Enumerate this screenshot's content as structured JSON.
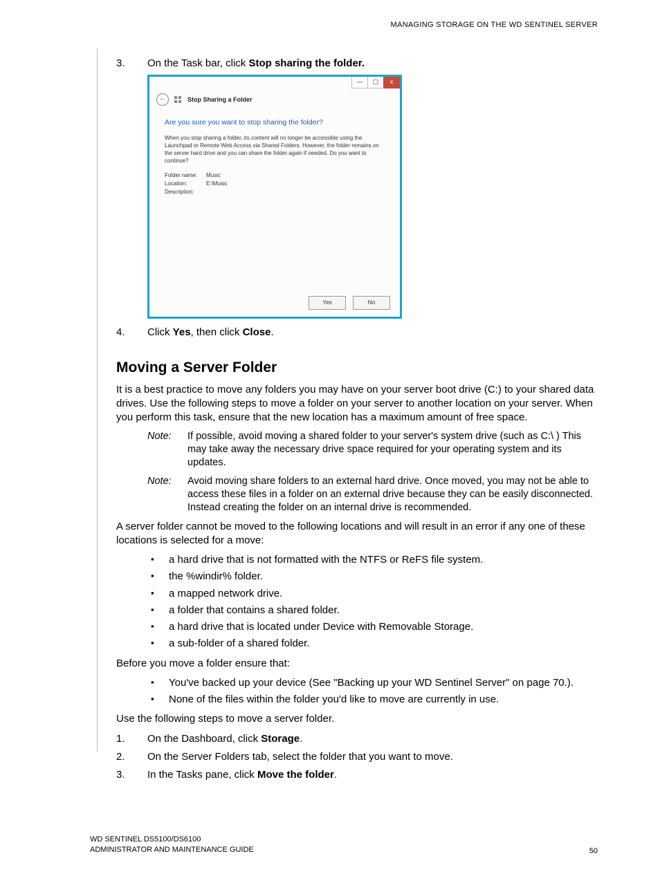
{
  "header": "MANAGING STORAGE ON THE WD SENTINEL SERVER",
  "step3": {
    "num": "3.",
    "pre": "On the Task bar, click ",
    "bold": "Stop sharing the folder."
  },
  "dialog": {
    "title": "Stop Sharing a Folder",
    "question": "Are you sure you want to stop sharing the folder?",
    "desc": "When you stop sharing a folder, its content will no longer be accessible using the Launchpad or Remote Web Access via Shared Folders. However, the folder remains on the server hard drive and you can share the folder again if needed. Do you want to continue?",
    "fn_label": "Folder name:",
    "fn_val": "Music",
    "loc_label": "Location:",
    "loc_val": "E:\\Music",
    "desc_label": "Description:",
    "yes": "Yes",
    "no": "No",
    "min": "—",
    "max": "▢",
    "close": "x"
  },
  "step4": {
    "num": "4.",
    "pre": "Click ",
    "b1": "Yes",
    "mid": ", then click ",
    "b2": "Close",
    "post": "."
  },
  "section_title": "Moving a Server Folder",
  "intro": "It is a best practice to move any folders you may have on your server boot drive (C:) to your shared data drives. Use the following steps to move a folder on your server to another location on your server. When you perform this task, ensure that the new location has a maximum amount of free space.",
  "note_label": "Note:",
  "note1": "If possible, avoid moving a shared folder to your server's system drive (such as C:\\ ) This may take away the necessary drive space required for your operating system and its updates.",
  "note2": "Avoid moving share folders to an external hard drive. Once moved, you may not be able to access these files in a folder on an external drive because they can be easily disconnected. Instead creating the folder on an internal drive is recommended.",
  "para2": "A server folder cannot be moved to the following locations and will result in an error if any one of these locations is selected for a move:",
  "bullets1": [
    "a hard drive that is not formatted with the NTFS or ReFS file system.",
    "the %windir% folder.",
    "a mapped network drive.",
    "a folder that contains a shared folder.",
    "a hard drive that is located under Device with Removable Storage.",
    "a sub-folder of a shared folder."
  ],
  "para3": "Before you move a folder ensure that:",
  "bullets2": [
    "You've backed up your device (See \"Backing up your WD Sentinel Server\" on page 70.).",
    "None of the files within the folder you'd like to move are currently in use."
  ],
  "para4": "Use the following steps to move a server folder.",
  "stepA": {
    "num": "1.",
    "pre": "On the Dashboard, click ",
    "bold": "Storage",
    "post": "."
  },
  "stepB": {
    "num": "2.",
    "txt": "On the Server Folders tab, select the folder that you want to move."
  },
  "stepC": {
    "num": "3.",
    "pre": "In the Tasks pane, click ",
    "bold": "Move the folder",
    "post": "."
  },
  "footer": {
    "line1": "WD SENTINEL DS5100/DS6100",
    "line2": "ADMINISTRATOR AND MAINTENANCE GUIDE",
    "page": "50"
  }
}
